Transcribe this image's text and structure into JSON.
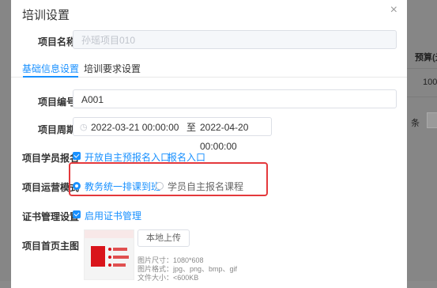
{
  "background": {
    "column_label": "预算(元",
    "cell_value": "100",
    "pager_text": "条"
  },
  "dialog": {
    "title": "培训设置"
  },
  "form": {
    "project_name_label": "项目名称",
    "project_name_value": "孙瑶项目010",
    "tabs": [
      {
        "label": "基础信息设置",
        "active": true
      },
      {
        "label": "培训要求设置",
        "active": false
      }
    ],
    "project_code_label": "项目编号",
    "project_code_value": "A001",
    "period_label": "项目周期",
    "period_start": "2022-03-21 00:00:00",
    "period_separator": "至",
    "period_end": "2022-04-20 00:00:00",
    "enroll_label": "项目学员报名",
    "enroll_checkbox_text": "开放自主预报名入口",
    "enroll_link": "报名入口",
    "operation_label": "项目运营模式",
    "operation_options": [
      {
        "label": "教务统一排课到班",
        "selected": true
      },
      {
        "label": "学员自主报名课程",
        "selected": false
      }
    ],
    "certificate_label": "证书管理设置",
    "certificate_checkbox_text": "启用证书管理",
    "homepage_image_label": "项目首页主图",
    "upload_button": "本地上传",
    "hints": [
      "图片尺寸：1080*608",
      "图片格式：jpg、png、bmp、gif",
      "文件大小：<600KB"
    ]
  },
  "colors": {
    "primary": "#1890ff",
    "highlight": "#e4393c"
  }
}
